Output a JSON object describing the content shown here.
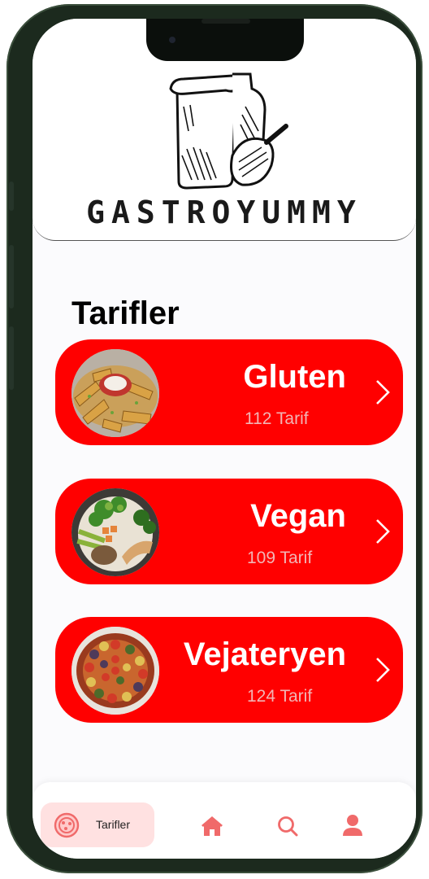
{
  "header": {
    "brand": "GASTROYUMMY"
  },
  "section_title": "Tarifler",
  "categories": [
    {
      "name": "Gluten",
      "count": "112 Tarif"
    },
    {
      "name": "Vegan",
      "count": "109 Tarif"
    },
    {
      "name": "Vejateryen",
      "count": "124 Tarif"
    }
  ],
  "nav": {
    "active_label": "Tarifler",
    "icons": [
      "pizza-icon",
      "home-icon",
      "search-icon",
      "user-icon"
    ]
  },
  "colors": {
    "accent": "#ff0000",
    "count_text": "#f2b5b5",
    "nav_icon": "#f06a6a",
    "nav_active_bg": "#ffe1e1"
  }
}
